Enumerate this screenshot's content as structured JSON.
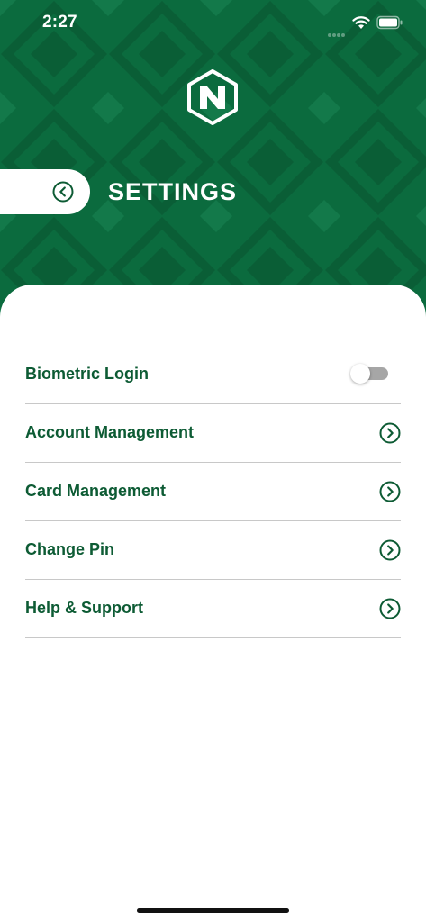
{
  "status_bar": {
    "time": "2:27"
  },
  "icons": {
    "back": "chevron-left-circle-icon",
    "logo": "bank-logo-icon",
    "chevron": "chevron-right-circle-icon"
  },
  "header": {
    "title": "SETTINGS"
  },
  "settings": {
    "items": [
      {
        "label": "Biometric Login",
        "control": "toggle",
        "enabled": false
      },
      {
        "label": "Account Management",
        "control": "chevron"
      },
      {
        "label": "Card Management",
        "control": "chevron"
      },
      {
        "label": "Change Pin",
        "control": "chevron"
      },
      {
        "label": "Help & Support",
        "control": "chevron"
      }
    ]
  },
  "colors": {
    "header_green": "#0b6b3e",
    "accent_green": "#0d5b34",
    "divider": "#c8c8c8",
    "toggle_off": "#a6a6a6"
  }
}
